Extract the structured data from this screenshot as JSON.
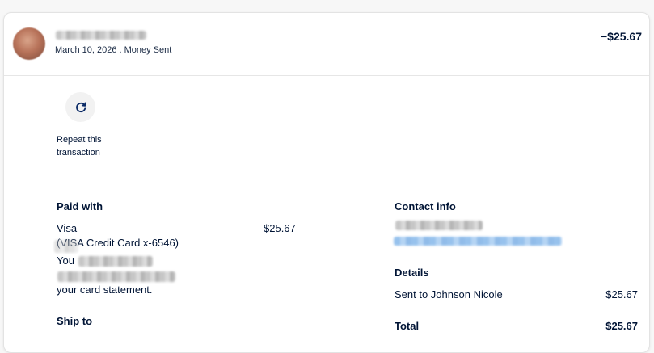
{
  "header": {
    "date_type": "March 10, 2026 . Money Sent",
    "amount": "−$25.67"
  },
  "repeat": {
    "icon": "refresh-icon",
    "label_line1": "Repeat this",
    "label_line2": "transaction"
  },
  "paid_with": {
    "title": "Paid with",
    "method": "Visa",
    "amount": "$25.67",
    "card": "(VISA Credit Card x-6546)",
    "note_line1_prefix": "You",
    "note_line3": "your card statement."
  },
  "ship_to": {
    "title": "Ship to"
  },
  "contact": {
    "title": "Contact info"
  },
  "details": {
    "title": "Details",
    "sent_to_label": "Sent to Johnson Nicole",
    "sent_to_amount": "$25.67",
    "total_label": "Total",
    "total_amount": "$25.67"
  }
}
